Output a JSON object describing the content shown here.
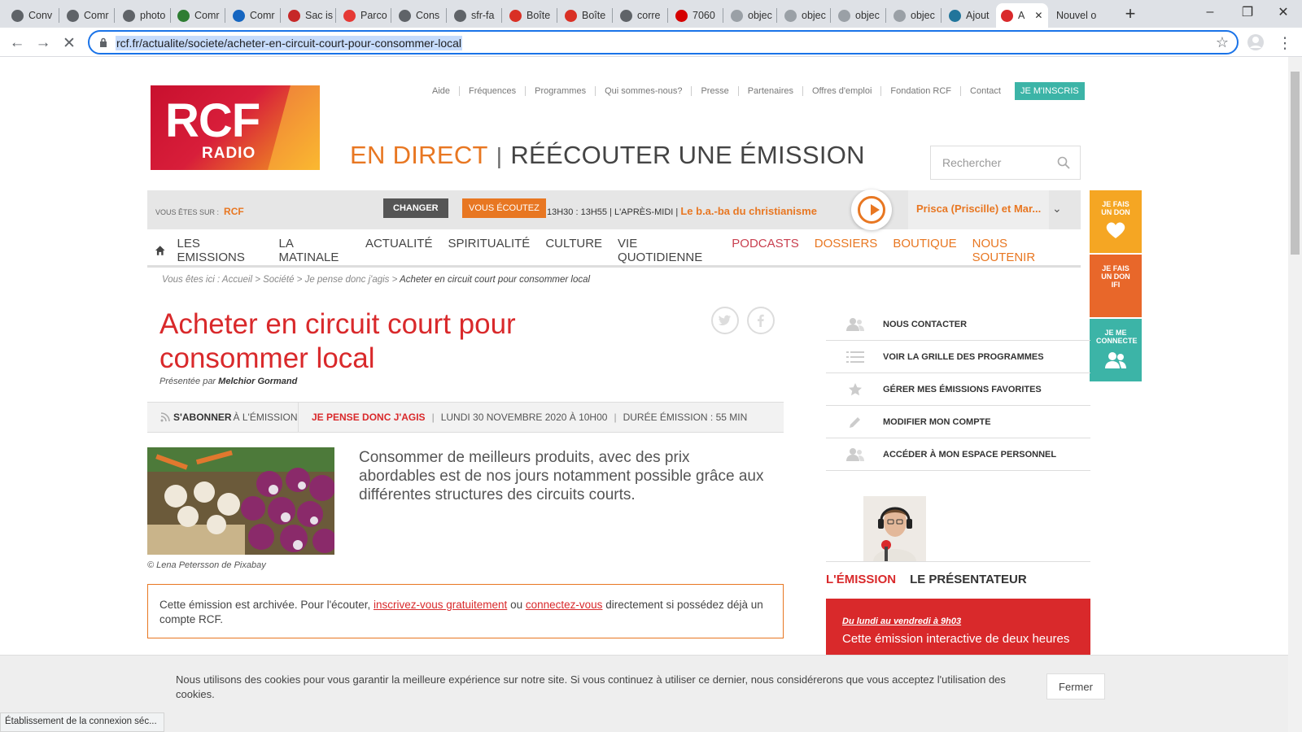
{
  "browser": {
    "tabs": [
      {
        "label": "Conv",
        "icon": "globe-icon",
        "color": "#5f6368"
      },
      {
        "label": "Comr",
        "icon": "globe-icon",
        "color": "#5f6368"
      },
      {
        "label": "photo",
        "icon": "globe-icon",
        "color": "#5f6368"
      },
      {
        "label": "Comr",
        "icon": "green-site-icon",
        "color": "#2e7d32"
      },
      {
        "label": "Comr",
        "icon": "blue-site-icon",
        "color": "#1565c0"
      },
      {
        "label": "Sac is",
        "icon": "red-site-icon",
        "color": "#c62828"
      },
      {
        "label": "Parco",
        "icon": "sfr-icon",
        "color": "#e53935"
      },
      {
        "label": "Cons",
        "icon": "globe-icon",
        "color": "#5f6368"
      },
      {
        "label": "sfr-fa",
        "icon": "globe-icon",
        "color": "#5f6368"
      },
      {
        "label": "Boîte",
        "icon": "gmail-icon",
        "color": "#d93025"
      },
      {
        "label": "Boîte",
        "icon": "gmail-icon",
        "color": "#d93025"
      },
      {
        "label": "corre",
        "icon": "globe-icon",
        "color": "#5f6368"
      },
      {
        "label": "7060",
        "icon": "red-loop-icon",
        "color": "#d50000"
      },
      {
        "label": "objec",
        "icon": "doc-icon",
        "color": "#9aa0a6"
      },
      {
        "label": "objec",
        "icon": "doc-icon",
        "color": "#9aa0a6"
      },
      {
        "label": "objec",
        "icon": "doc-icon",
        "color": "#9aa0a6"
      },
      {
        "label": "objec",
        "icon": "doc-icon",
        "color": "#9aa0a6"
      },
      {
        "label": "Ajout",
        "icon": "wordpress-icon",
        "color": "#21759b"
      },
      {
        "label": "A",
        "icon": "rcf-icon",
        "color": "#d9292b"
      },
      {
        "label": "Nouvel o",
        "icon": "",
        "color": ""
      }
    ],
    "url": "rcf.fr/actualite/societe/acheter-en-circuit-court-pour-consommer-local",
    "status_text": "Établissement de la connexion séc..."
  },
  "colors": {
    "orange": "#e87722",
    "red": "#d9292b",
    "teal": "#3cb4a7"
  },
  "topnav": [
    "Aide",
    "Fréquences",
    "Programmes",
    "Qui sommes-nous?",
    "Presse",
    "Partenaires",
    "Offres d'emploi",
    "Fondation RCF",
    "Contact"
  ],
  "inscris": "JE M'INSCRIS",
  "logo": {
    "big": "RCF",
    "small": "RADIO"
  },
  "header": {
    "direct": "EN DIRECT",
    "reecouter": "RÉÉCOUTER UNE ÉMISSION",
    "search_placeholder": "Rechercher"
  },
  "player": {
    "vous_etes": "VOUS ÊTES SUR :",
    "station": "RCF",
    "changer": "CHANGER",
    "ecoutez": "VOUS ÉCOUTEZ",
    "time": "13H30 : 13H55 | L'APRÈS-MIDI |",
    "program": "Le b.a.-ba du christianisme",
    "next": "Prisca (Priscille) et Mar..."
  },
  "side_float": [
    {
      "label": "JE FAIS UN DON",
      "color": "#f5a623"
    },
    {
      "label": "JE FAIS UN DON IFI",
      "color": "#e8672a"
    },
    {
      "label": "JE ME CONNECTE",
      "color": "#3cb4a7"
    }
  ],
  "mainnav": [
    "LES EMISSIONS",
    "LA MATINALE",
    "ACTUALITÉ",
    "SPIRITUALITÉ",
    "CULTURE",
    "VIE QUOTIDIENNE",
    "PODCASTS",
    "DOSSIERS",
    "BOUTIQUE",
    "NOUS SOUTENIR"
  ],
  "breadcrumb": {
    "prefix": "Vous êtes ici : Accueil > Société > Je pense donc j'agis >",
    "current": "Acheter en circuit court pour consommer local"
  },
  "article": {
    "title": "Acheter en circuit court pour consommer local",
    "byline_prefix": "Présentée par",
    "presenter": "Melchior Gormand",
    "subscribe_bold": "S'ABONNER",
    "subscribe_rest": "À L'ÉMISSION",
    "emission": "JE PENSE DONC J'AGIS",
    "date": "LUNDI 30 NOVEMBRE 2020 À 10H00",
    "duration": "DURÉE ÉMISSION : 55 MIN",
    "lead": "Consommer de meilleurs produits, avec des prix abordables est de nos jours notamment possible grâce aux différentes structures des circuits courts.",
    "caption": "© Lena Petersson de Pixabay",
    "archive_1": "Cette émission est archivée. Pour l'écouter,",
    "archive_link1": "inscrivez-vous gratuitement",
    "archive_or": "ou",
    "archive_link2": "connectez-vous",
    "archive_2": "directement si possédez déjà un compte RCF."
  },
  "sidebar": {
    "items": [
      "NOUS CONTACTER",
      "VOIR LA GRILLE DES PROGRAMMES",
      "GÉRER MES ÉMISSIONS FAVORITES",
      "MODIFIER MON COMPTE",
      "ACCÉDER À MON ESPACE PERSONNEL"
    ],
    "tab1": "L'ÉMISSION",
    "tab2": "LE PRÉSENTATEUR",
    "when": "Du lundi au vendredi à 9h03",
    "desc": "Cette émission interactive de deux heures"
  },
  "cookie": {
    "text": "Nous utilisons des cookies pour vous garantir la meilleure expérience sur notre site. Si vous continuez à utiliser ce dernier, nous considérerons que vous acceptez l'utilisation des cookies.",
    "button": "Fermer"
  }
}
